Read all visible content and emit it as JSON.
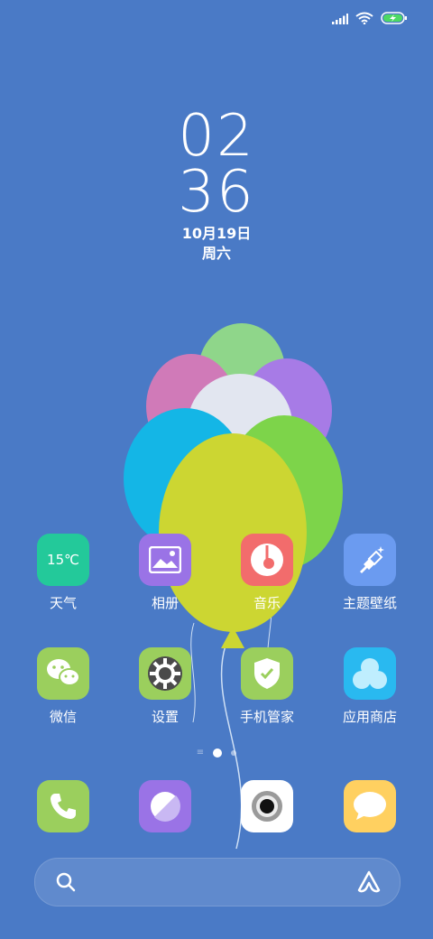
{
  "status_bar": {
    "signal_icon": "signal-icon",
    "wifi_icon": "wifi-icon",
    "battery_icon": "battery-charging-icon",
    "battery_color": "#4cd964"
  },
  "clock": {
    "hour": "02",
    "minute": "36",
    "date": "10月19日",
    "weekday": "周六"
  },
  "weather_temp": "15℃",
  "apps_row1": [
    {
      "label": "天气",
      "color": "#23c99a"
    },
    {
      "label": "相册",
      "color": "#9a73e6"
    },
    {
      "label": "音乐",
      "color": "#f26c6c"
    },
    {
      "label": "主题壁纸",
      "color": "#6b9bf0"
    }
  ],
  "apps_row2": [
    {
      "label": "微信",
      "color": "#9bcf5d"
    },
    {
      "label": "设置",
      "color": "#9bcf5d"
    },
    {
      "label": "手机管家",
      "color": "#9bcf5d"
    },
    {
      "label": "应用商店",
      "color": "#29b9f0"
    }
  ],
  "dock": [
    {
      "name": "phone",
      "color": "#9bcf5d"
    },
    {
      "name": "browser",
      "color": "#9a73e6"
    },
    {
      "name": "camera",
      "color": "#ffffff"
    },
    {
      "name": "messages",
      "color": "#ffd060"
    }
  ],
  "page_indicator": {
    "pages": 2,
    "current": 1
  },
  "search": {
    "search_icon": "search-icon",
    "assistant_icon": "assistant-icon"
  }
}
